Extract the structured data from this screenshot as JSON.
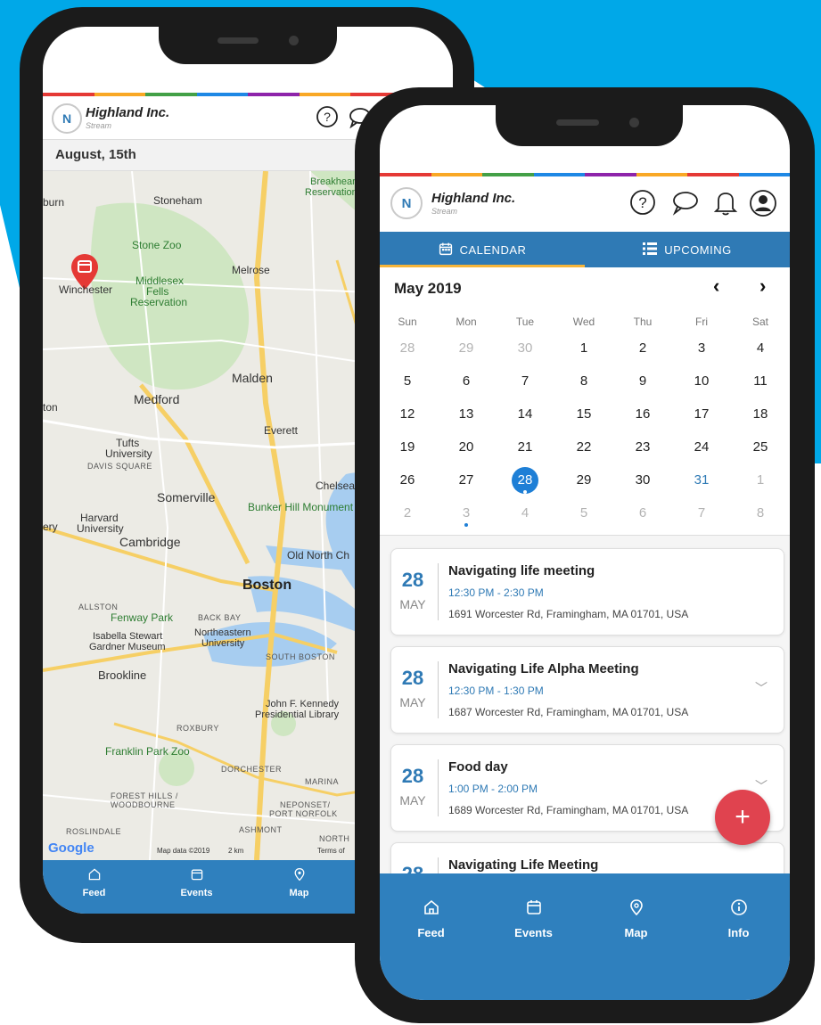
{
  "colors": {
    "background_blue": "#00a8e8",
    "brand_blue": "#2f7ab5",
    "nav_blue": "#2f80be",
    "fab_red": "#e0434f",
    "phone_frame": "#1b1b1b"
  },
  "brand": {
    "title": "Highland Inc.",
    "subtitle": "Stream",
    "logo_letter": "N"
  },
  "header_icons": [
    "help-icon",
    "chat-icon",
    "bell-icon",
    "profile-icon"
  ],
  "back_phone": {
    "date_banner": "August, 15th",
    "map_labels": {
      "stoneham": "Stoneham",
      "breakheart": "Breakheart",
      "reservation": "Reservation",
      "woburn": "burn",
      "stone_zoo": "Stone Zoo",
      "winchester": "Winchester",
      "melrose": "Melrose",
      "middlesex": "Middlesex",
      "fells": "Fells",
      "fells_res": "Reservation",
      "malden": "Malden",
      "medford": "Medford",
      "everett": "Everett",
      "tufts": "Tufts",
      "tufts_univ": "University",
      "davis": "DAVIS SQUARE",
      "somerville": "Somerville",
      "chelsea": "Chelsea",
      "bunker": "Bunker Hill Monument",
      "harvard": "Harvard",
      "harvard_univ": "University",
      "cambridge": "Cambridge",
      "old_north": "Old North Ch",
      "boston": "Boston",
      "allston": "ALLSTON",
      "fenway": "Fenway Park",
      "back_bay": "BACK BAY",
      "isabella": "Isabella Stewart",
      "gardner": "Gardner Museum",
      "northeastern": "Northeastern",
      "ne_univ": "University",
      "south_boston": "SOUTH BOSTON",
      "brookline": "Brookline",
      "jfk": "John F. Kennedy",
      "jfk_lib": "Presidential Library",
      "roxbury": "ROXBURY",
      "franklin": "Franklin Park Zoo",
      "dorchester": "DORCHESTER",
      "marina": "MARINA",
      "forest_hills": "FOREST HILLS /",
      "woodbourne": "WOODBOURNE",
      "neponset": "NEPONSET/",
      "port_norfolk": "PORT NORFOLK",
      "roslindale": "ROSLINDALE",
      "ashmont": "ASHMONT",
      "north": "NORTH",
      "google": "Google",
      "map_data": "Map data ©2019",
      "scale": "2 km",
      "terms": "Terms of",
      "tuon": "ton",
      "ery": "ery"
    },
    "nav": [
      {
        "label": "Feed",
        "icon": "home-icon"
      },
      {
        "label": "Events",
        "icon": "calendar-icon"
      },
      {
        "label": "Map",
        "icon": "map-pin-icon"
      }
    ]
  },
  "front_phone": {
    "tabs": [
      {
        "label": "CALENDAR",
        "icon": "calendar-icon",
        "active": true
      },
      {
        "label": "UPCOMING",
        "icon": "list-icon",
        "active": false
      }
    ],
    "calendar": {
      "month": "May 2019",
      "prev": "‹",
      "next": "›",
      "weekdays": [
        "Sun",
        "Mon",
        "Tue",
        "Wed",
        "Thu",
        "Fri",
        "Sat"
      ],
      "weeks": [
        [
          "28",
          "29",
          "30",
          "1",
          "2",
          "3",
          "4"
        ],
        [
          "5",
          "6",
          "7",
          "8",
          "9",
          "10",
          "11"
        ],
        [
          "12",
          "13",
          "14",
          "15",
          "16",
          "17",
          "18"
        ],
        [
          "19",
          "20",
          "21",
          "22",
          "23",
          "24",
          "25"
        ],
        [
          "26",
          "27",
          "28",
          "29",
          "30",
          "31",
          "1"
        ],
        [
          "2",
          "3",
          "4",
          "5",
          "6",
          "7",
          "8"
        ]
      ],
      "selected": "28",
      "today_blue": "31"
    },
    "events": [
      {
        "day": "28",
        "month": "MAY",
        "title": "Navigating life meeting",
        "time": "12:30 PM - 2:30 PM",
        "address": "1691 Worcester Rd, Framingham, MA 01701, USA",
        "chevron": ""
      },
      {
        "day": "28",
        "month": "MAY",
        "title": "Navigating Life Alpha Meeting",
        "time": "12:30 PM - 1:30 PM",
        "address": "1687 Worcester Rd, Framingham, MA 01701, USA",
        "chevron": "﹀"
      },
      {
        "day": "28",
        "month": "MAY",
        "title": "Food day",
        "time": "1:00 PM - 2:00 PM",
        "address": "1689 Worcester Rd, Framingham, MA 01701, USA",
        "chevron": "﹀"
      },
      {
        "day": "28",
        "month": "",
        "title": "Navigating Life Meeting",
        "time": "",
        "address": "",
        "chevron": ""
      }
    ],
    "fab_label": "+",
    "nav": [
      {
        "label": "Feed",
        "icon": "home-icon"
      },
      {
        "label": "Events",
        "icon": "calendar-icon"
      },
      {
        "label": "Map",
        "icon": "map-pin-icon"
      },
      {
        "label": "Info",
        "icon": "info-icon"
      }
    ]
  }
}
